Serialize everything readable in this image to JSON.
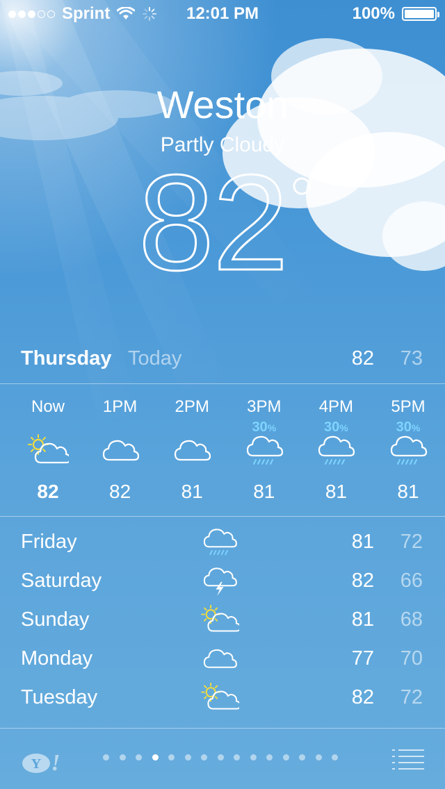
{
  "status_bar": {
    "carrier": "Sprint",
    "signal_bars_filled": 3,
    "signal_bars_total": 5,
    "time": "12:01 PM",
    "battery": "100%",
    "icons": [
      "wifi-icon",
      "activity-spinner-icon",
      "battery-icon"
    ]
  },
  "current": {
    "city": "Weston",
    "condition": "Partly Cloudy",
    "temperature": "82",
    "degree_symbol": "°"
  },
  "today": {
    "day": "Thursday",
    "label": "Today",
    "high": "82",
    "low": "73"
  },
  "hourly": [
    {
      "time": "Now",
      "pop": "",
      "icon": "partly-cloudy-icon",
      "temp": "82"
    },
    {
      "time": "1PM",
      "pop": "",
      "icon": "cloudy-icon",
      "temp": "82"
    },
    {
      "time": "2PM",
      "pop": "",
      "icon": "cloudy-icon",
      "temp": "81"
    },
    {
      "time": "3PM",
      "pop": "30",
      "icon": "rain-icon",
      "temp": "81"
    },
    {
      "time": "4PM",
      "pop": "30",
      "icon": "rain-icon",
      "temp": "81"
    },
    {
      "time": "5PM",
      "pop": "30",
      "icon": "rain-icon",
      "temp": "81"
    }
  ],
  "pop_unit": "%",
  "daily": [
    {
      "day": "Friday",
      "icon": "rain-icon",
      "high": "81",
      "low": "72"
    },
    {
      "day": "Saturday",
      "icon": "thunderstorm-icon",
      "high": "82",
      "low": "66"
    },
    {
      "day": "Sunday",
      "icon": "partly-cloudy-icon",
      "high": "81",
      "low": "68"
    },
    {
      "day": "Monday",
      "icon": "cloudy-icon",
      "high": "77",
      "low": "70"
    },
    {
      "day": "Tuesday",
      "icon": "partly-cloudy-icon",
      "high": "82",
      "low": "72"
    }
  ],
  "bottom_bar": {
    "logo": "Y!",
    "page_count": 15,
    "active_page": 4
  },
  "colors": {
    "sky_top": "#3d8fd2",
    "sky_bottom": "#66acdd",
    "sun_yellow": "#f5dd3a",
    "rain_blue": "#7fd4ff"
  }
}
